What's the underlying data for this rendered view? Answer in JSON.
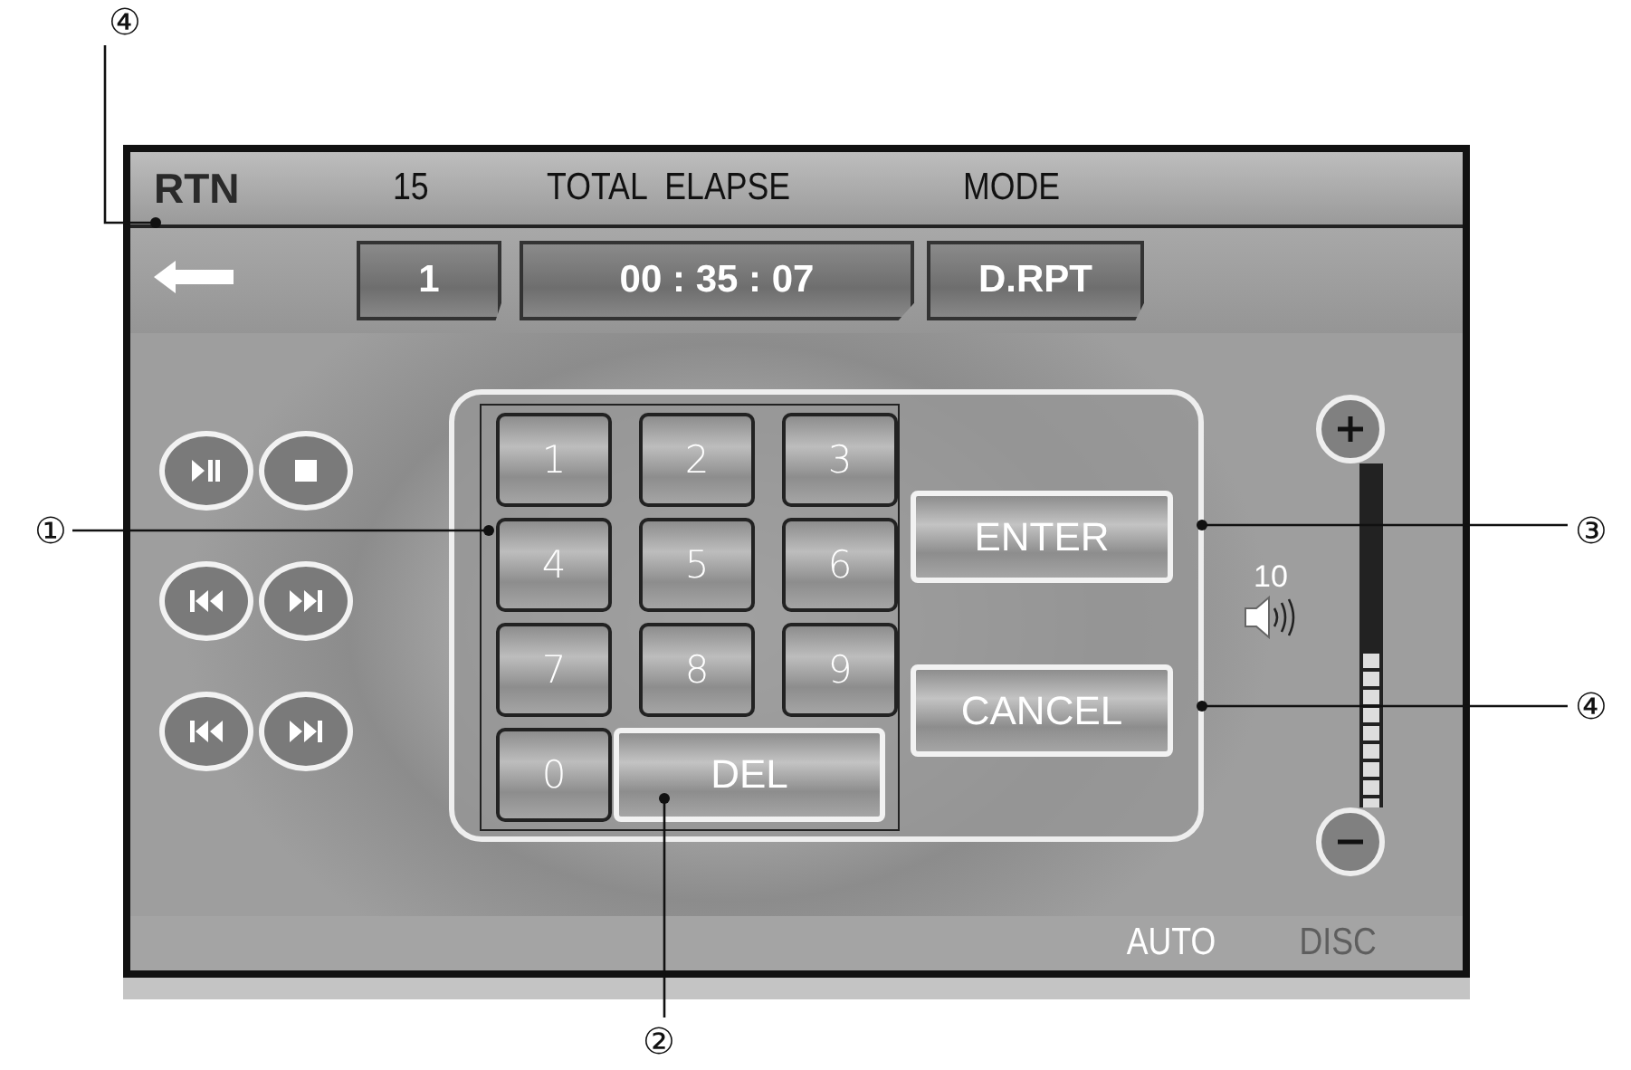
{
  "header": {
    "return_label": "RTN",
    "track_number": "15",
    "time_label": "TOTAL  ELAPSE",
    "mode_label": "MODE"
  },
  "fields": [
    {
      "value": "1"
    },
    {
      "value": "00 : 35 : 07"
    },
    {
      "value": "D.RPT"
    }
  ],
  "keypad": {
    "keys": [
      "1",
      "2",
      "3",
      "4",
      "5",
      "6",
      "7",
      "8",
      "9",
      "0"
    ],
    "delete": "DEL"
  },
  "actions": {
    "enter": "ENTER",
    "cancel": "CANCEL"
  },
  "volume": {
    "reading": "10",
    "level": 0.45
  },
  "status_bar": [
    {
      "label": "AUTO",
      "active": true
    },
    {
      "label": "DISC",
      "active": false
    }
  ],
  "callouts": [
    "④",
    "①",
    "②",
    "③",
    "④"
  ]
}
